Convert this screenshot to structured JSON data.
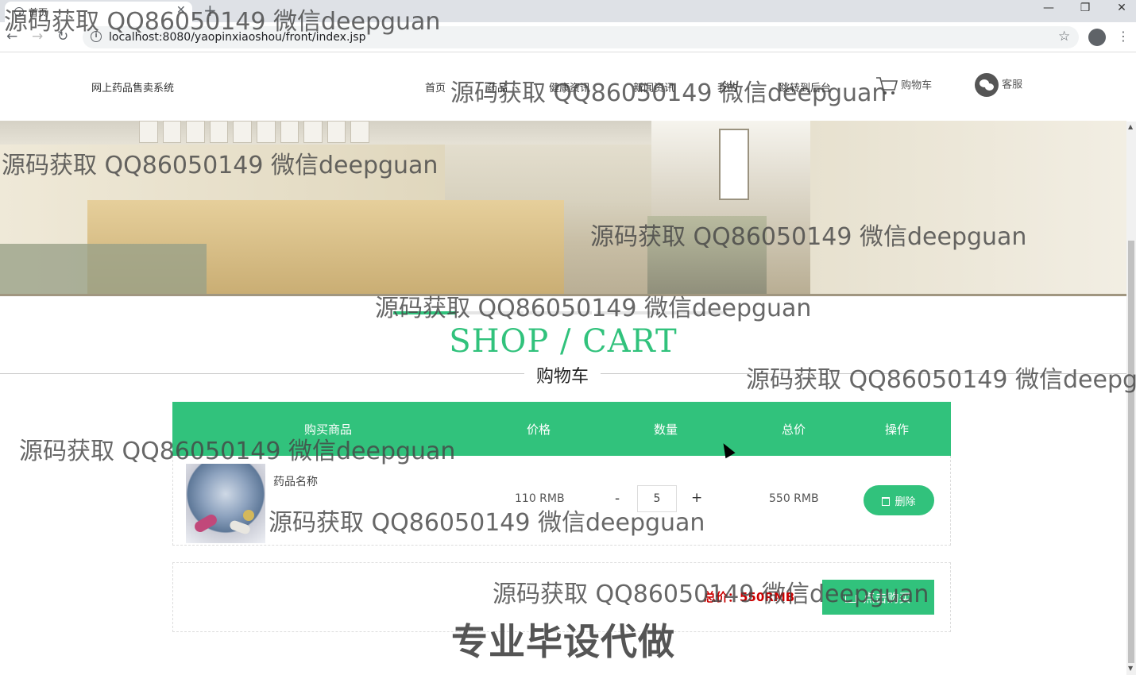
{
  "browser": {
    "tab_title": "首页",
    "url": "localhost:8080/yaopinxiaoshou/front/index.jsp",
    "new_tab": "+",
    "tab_close": "✕",
    "minimize": "—",
    "restore": "❐",
    "close": "✕"
  },
  "header": {
    "site_title": "网上药品售卖系统",
    "menu": [
      "首页",
      "药品",
      "健康资讯",
      "新闻资讯",
      "我的",
      "跳转到后台"
    ],
    "cart_label": "购物车",
    "service_label": "客服"
  },
  "section": {
    "title_en": "SHOP / CART",
    "title_cn": "购物车"
  },
  "table": {
    "columns": [
      "购买商品",
      "价格",
      "数量",
      "总价",
      "操作"
    ],
    "rows": [
      {
        "name": "药品名称",
        "price": "110 RMB",
        "quantity": "5",
        "total": "550 RMB",
        "delete_label": "删除"
      }
    ],
    "minus": "-",
    "plus": "+"
  },
  "summary": {
    "total_label": "总价：550RMB",
    "buy_label": "点击购买"
  },
  "watermarks": {
    "text": "源码获取 QQ86050149 微信deepguan",
    "big": "专业毕设代做"
  },
  "colors": {
    "accent": "#31c27c",
    "total_red": "#cc0000"
  }
}
